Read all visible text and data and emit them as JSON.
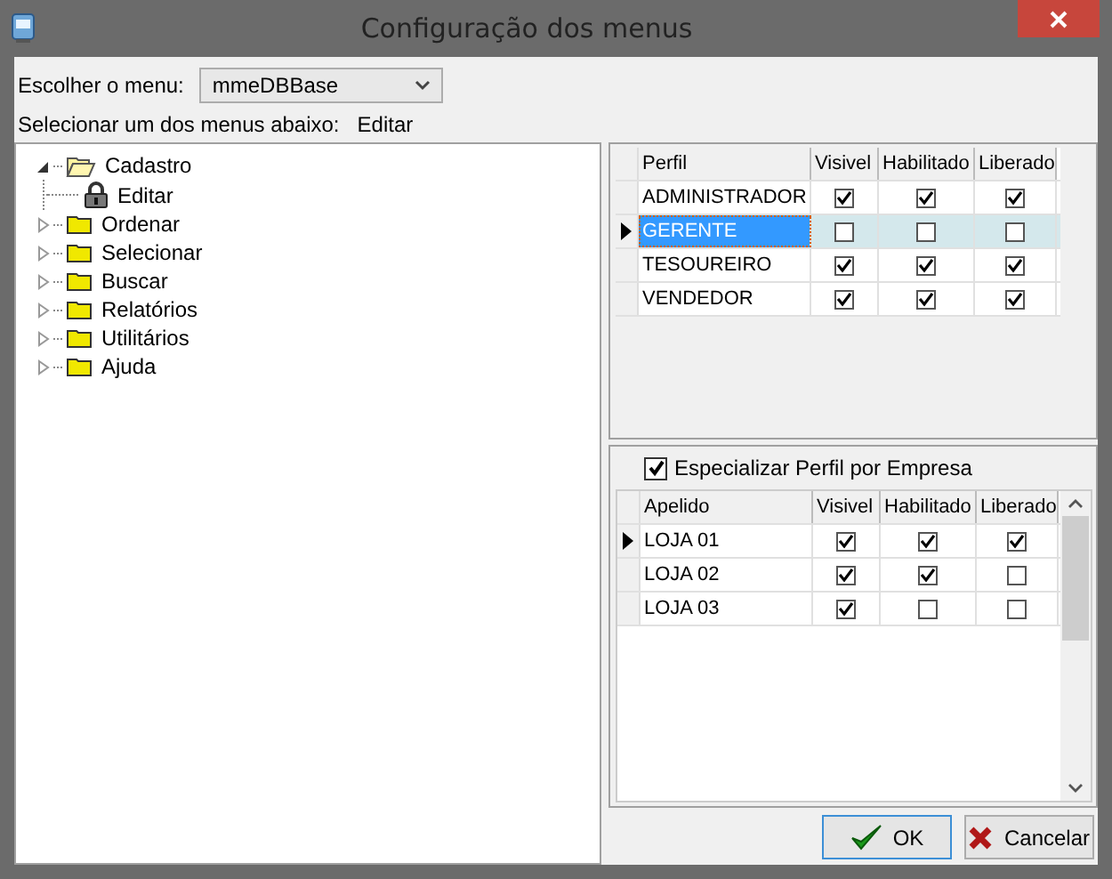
{
  "window": {
    "title": "Configuração dos menus"
  },
  "menu_select": {
    "label": "Escolher o menu:",
    "value": "mmeDBBase"
  },
  "selection": {
    "label": "Selecionar um  dos menus abaixo:",
    "value": "Editar"
  },
  "tree": [
    {
      "label": "Cadastro",
      "kind": "folder",
      "expanded": true,
      "children": [
        {
          "label": "Editar",
          "kind": "locked"
        }
      ]
    },
    {
      "label": "Ordenar",
      "kind": "folder",
      "expanded": false
    },
    {
      "label": "Selecionar",
      "kind": "folder",
      "expanded": false
    },
    {
      "label": "Buscar",
      "kind": "folder",
      "expanded": false
    },
    {
      "label": "Relatórios",
      "kind": "folder",
      "expanded": false
    },
    {
      "label": "Utilitários",
      "kind": "folder",
      "expanded": false
    },
    {
      "label": "Ajuda",
      "kind": "folder",
      "expanded": false
    }
  ],
  "profiles": {
    "columns": [
      "Perfil",
      "Visivel",
      "Habilitado",
      "Liberado"
    ],
    "rows": [
      {
        "name": "ADMINISTRADOR",
        "visivel": true,
        "habilitado": true,
        "liberado": true,
        "selected": false
      },
      {
        "name": "GERENTE",
        "visivel": false,
        "habilitado": false,
        "liberado": false,
        "selected": true
      },
      {
        "name": "TESOUREIRO",
        "visivel": true,
        "habilitado": true,
        "liberado": true,
        "selected": false
      },
      {
        "name": "VENDEDOR",
        "visivel": true,
        "habilitado": true,
        "liberado": true,
        "selected": false
      }
    ]
  },
  "specialize": {
    "label": "Especializar Perfil por Empresa",
    "checked": true
  },
  "companies": {
    "columns": [
      "Apelido",
      "Visivel",
      "Habilitado",
      "Liberado"
    ],
    "rows": [
      {
        "name": "LOJA 01",
        "visivel": true,
        "habilitado": true,
        "liberado": true,
        "selected": true
      },
      {
        "name": "LOJA 02",
        "visivel": true,
        "habilitado": true,
        "liberado": false,
        "selected": false
      },
      {
        "name": "LOJA 03",
        "visivel": true,
        "habilitado": false,
        "liberado": false,
        "selected": false
      }
    ]
  },
  "buttons": [
    {
      "label": "OK",
      "kind": "ok"
    },
    {
      "label": "Cancelar",
      "kind": "cancel"
    }
  ]
}
